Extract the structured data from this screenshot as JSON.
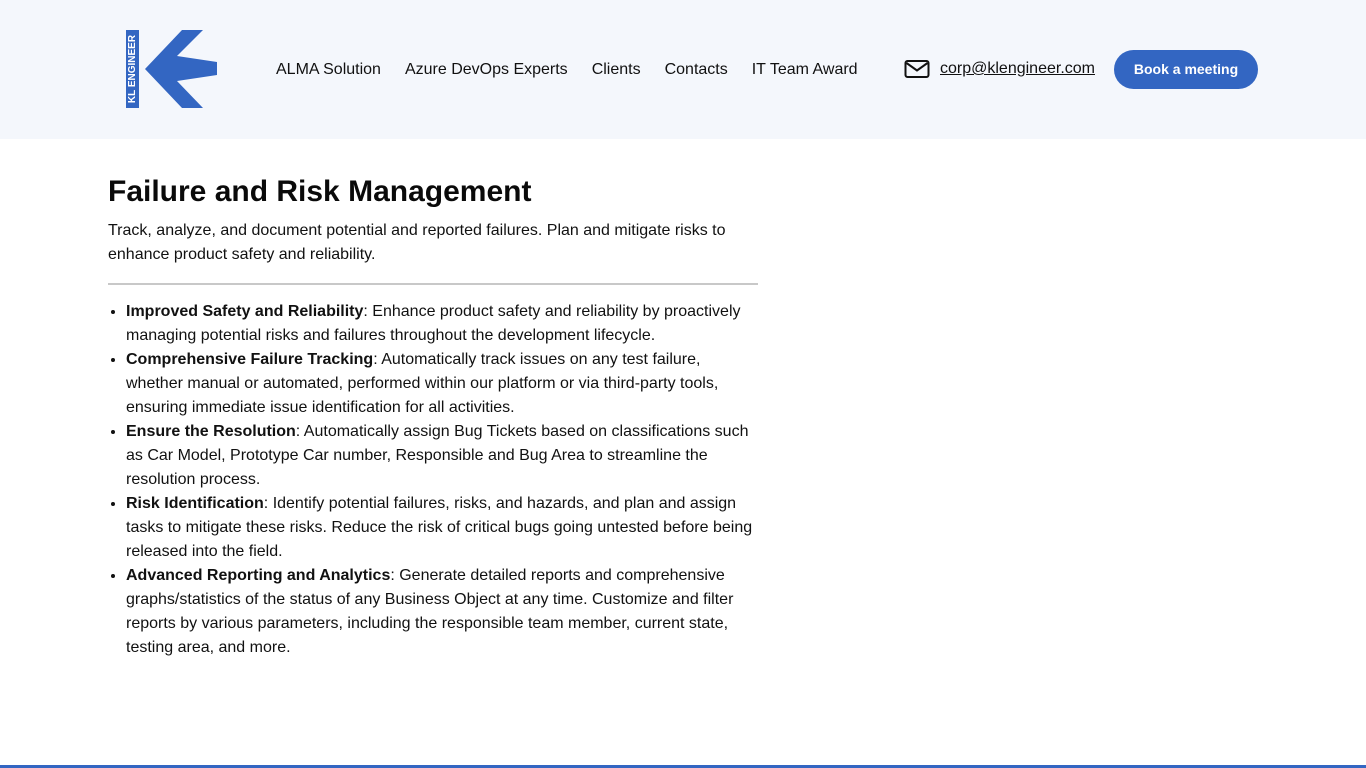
{
  "header": {
    "logo": {
      "text": "KL ENGINEER",
      "icon": "left-arrow-logo"
    },
    "nav": [
      {
        "label": "ALMA Solution"
      },
      {
        "label": "Azure DevOps Experts"
      },
      {
        "label": "Clients"
      },
      {
        "label": "Contacts"
      },
      {
        "label": "IT Team Award"
      }
    ],
    "contact": {
      "icon": "envelope-icon",
      "email": "corp@klengineer.com"
    },
    "cta_label": "Book a meeting"
  },
  "main": {
    "title": "Failure and Risk Management",
    "lead": "Track, analyze, and document potential and reported failures. Plan and mitigate risks to enhance product safety and reliability.",
    "features": [
      {
        "title": "Improved Safety and Reliability",
        "text": ": Enhance product safety and reliability by proactively managing potential risks and failures throughout the development lifecycle."
      },
      {
        "title": "Comprehensive Failure Tracking",
        "text": ": Automatically track issues on any test failure, whether manual or automated, performed within our platform or via third-party tools, ensuring immediate issue identification for all activities."
      },
      {
        "title": "Ensure the Resolution",
        "text": ": Automatically assign Bug Tickets based on classifications such as Car Model, Prototype Car number, Responsible and Bug Area to streamline the resolution process."
      },
      {
        "title": "Risk Identification",
        "text": ": Identify potential failures, risks, and hazards, and plan and assign tasks to mitigate these risks. Reduce the risk of critical bugs going untested before being released into the field."
      },
      {
        "title": "Advanced Reporting and Analytics",
        "text": ": Generate detailed reports and comprehensive graphs/statistics of the status of any Business Object at any time. Customize and filter reports by various parameters, including the responsible team member, current state, testing area, and more."
      }
    ]
  },
  "colors": {
    "brand": "#3366c2",
    "header_bg": "#f4f7fc",
    "text": "#111111",
    "divider": "#c8c8c8"
  }
}
